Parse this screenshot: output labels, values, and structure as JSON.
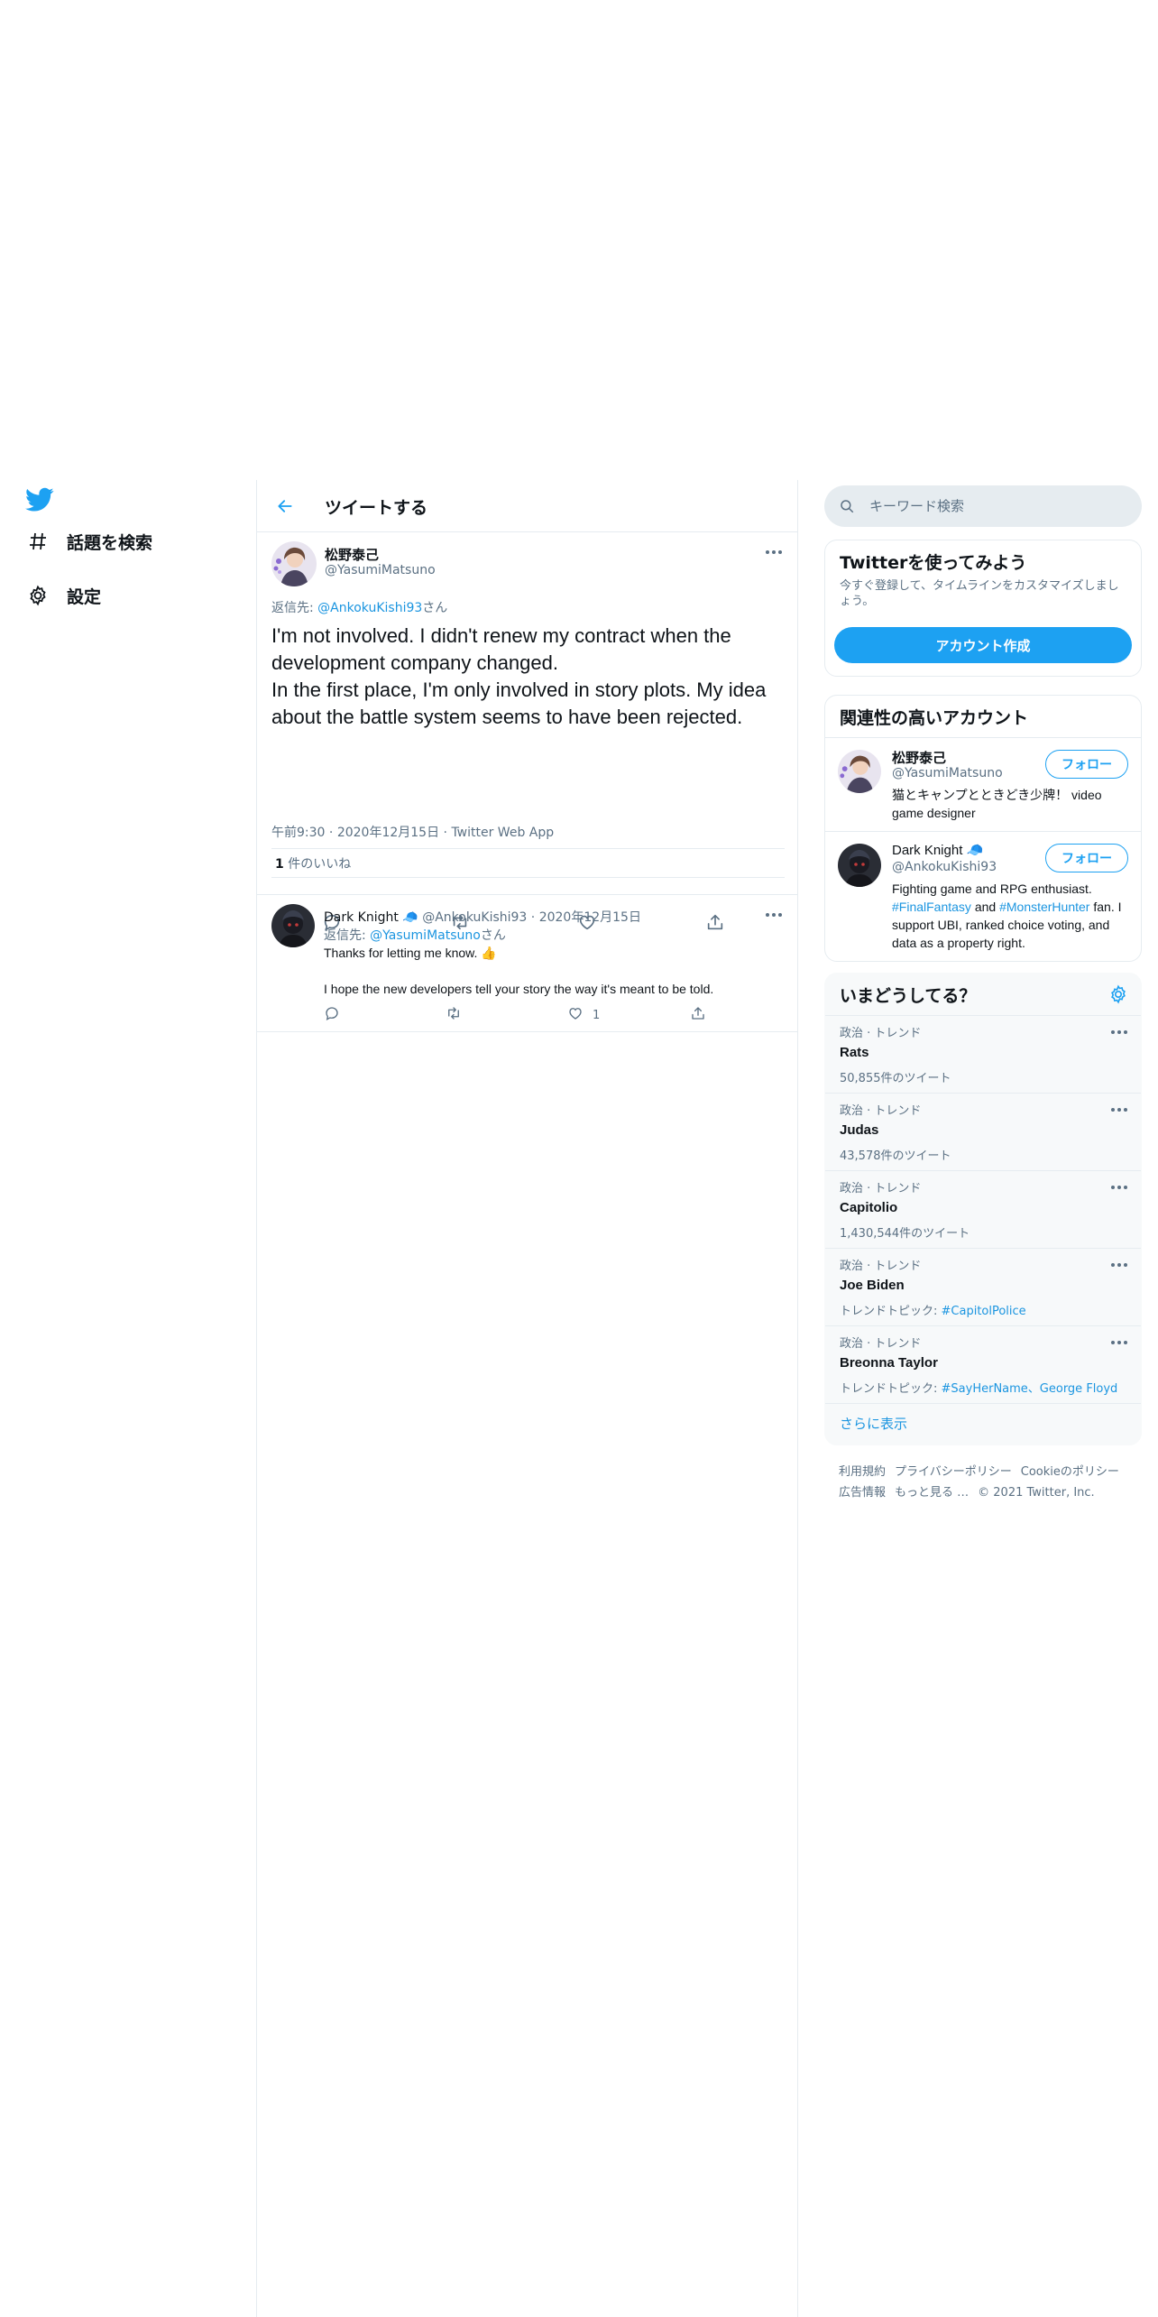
{
  "colors": {
    "accent": "#1da1f2",
    "link": "#1b95e0",
    "text": "#0f1419",
    "muted": "#5b7083",
    "border": "#e6ecf0"
  },
  "nav": {
    "logo_icon": "twitter-bird-icon",
    "items": [
      {
        "icon": "hashtag-icon",
        "label": "話題を検索"
      },
      {
        "icon": "gear-icon",
        "label": "設定"
      }
    ]
  },
  "header": {
    "title": "ツイートする"
  },
  "tweet": {
    "name": "松野泰己",
    "handle": "@YasumiMatsuno",
    "reply_prefix": "返信先: ",
    "reply_to": "@AnkokuKishi93",
    "reply_suffix": "さん",
    "text_line1": "I'm not involved. I didn't renew my contract when the development company changed.",
    "text_line2": "In the first place, I'm only involved in story plots. My idea about the battle system seems to have been rejected.",
    "time": "午前9:30",
    "date": "2020年12月15日",
    "source": "Twitter Web App",
    "like_count": "1",
    "like_label": " 件のいいね"
  },
  "reply": {
    "name": "Dark Knight",
    "name_emoji": "🧢",
    "handle": "@AnkokuKishi93",
    "date": "2020年12月15日",
    "reply_prefix": "返信先: ",
    "reply_to": "@YasumiMatsuno",
    "reply_suffix": "さん",
    "text1": "Thanks for letting me know. 👍",
    "text2": "I hope the new developers tell your story the way it's meant to be told.",
    "like_count": "1"
  },
  "search": {
    "placeholder": "キーワード検索"
  },
  "signup": {
    "title": "Twitterを使ってみよう",
    "desc": "今すぐ登録して、タイムラインをカスタマイズしましょう。",
    "button": "アカウント作成"
  },
  "relevant": {
    "title": "関連性の高いアカウント",
    "follow_label": "フォロー",
    "accounts": [
      {
        "name": "松野泰己",
        "handle": "@YasumiMatsuno",
        "bio": "猫とキャンプとときどき少牌！ video game designer"
      },
      {
        "name": "Dark Knight 🧢",
        "handle": "@AnkokuKishi93",
        "bio_a": "Fighting game and RPG enthusiast. ",
        "bio_tag1": "#FinalFantasy",
        "bio_b": " and ",
        "bio_tag2": "#MonsterHunter",
        "bio_c": " fan. I support UBI, ranked choice voting, and data as a property right."
      }
    ]
  },
  "trends": {
    "title": "いまどうしてる？",
    "items": [
      {
        "context": "政治 · トレンド",
        "title": "Rats",
        "count": "50,855件のツイート"
      },
      {
        "context": "政治 · トレンド",
        "title": "Judas",
        "count": "43,578件のツイート"
      },
      {
        "context": "政治 · トレンド",
        "title": "Capitolio",
        "count": "1,430,544件のツイート"
      },
      {
        "context": "政治 · トレンド",
        "title": "Joe Biden",
        "topic_prefix": "トレンドトピック: ",
        "topics": "#CapitolPolice"
      },
      {
        "context": "政治 · トレンド",
        "title": "Breonna Taylor",
        "topic_prefix": "トレンドトピック: ",
        "topics": "#SayHerName、George Floyd"
      }
    ],
    "show_more": "さらに表示"
  },
  "footer": {
    "links": [
      "利用規約",
      "プライバシーポリシー",
      "Cookieのポリシー",
      "広告情報",
      "もっと見る …"
    ],
    "copyright": "© 2021 Twitter, Inc."
  }
}
